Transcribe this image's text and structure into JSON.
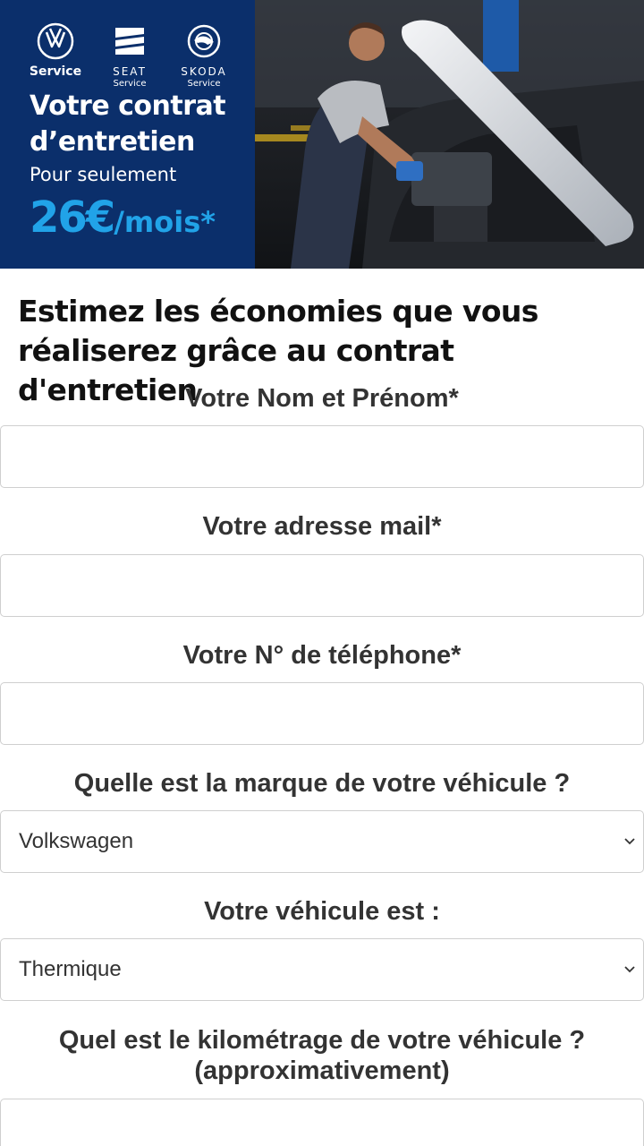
{
  "banner": {
    "brands": [
      {
        "name": "",
        "sub": "Service",
        "icon": "vw-logo-icon"
      },
      {
        "name": "SEAT",
        "sub": "Service",
        "icon": "seat-logo-icon"
      },
      {
        "name": "SKODA",
        "sub": "Service",
        "icon": "skoda-logo-icon"
      }
    ],
    "title_line1": "Votre contrat",
    "title_line2": "d’entretien",
    "subtitle": "Pour seulement",
    "price_amount": "26€",
    "price_unit": "/mois*",
    "photo_icon": "mechanic-engine-photo",
    "colors": {
      "navy": "#0b2f6b",
      "accent": "#21a3e8"
    }
  },
  "form": {
    "heading": "Estimez les économies que vous réaliserez grâce au contrat d'entretien",
    "name_label": "Votre Nom et Prénom*",
    "name_value": "",
    "email_label": "Votre adresse mail*",
    "email_value": "",
    "phone_label": "Votre N° de téléphone*",
    "phone_value": "",
    "brand_label": "Quelle est la marque de votre véhicule ?",
    "brand_selected": "Volkswagen",
    "type_label": "Votre véhicule est :",
    "type_selected": "Thermique",
    "mileage_label_line1": "Quel est le kilométrage de votre véhicule ?",
    "mileage_label_line2": "(approximativement)",
    "mileage_value": ""
  }
}
